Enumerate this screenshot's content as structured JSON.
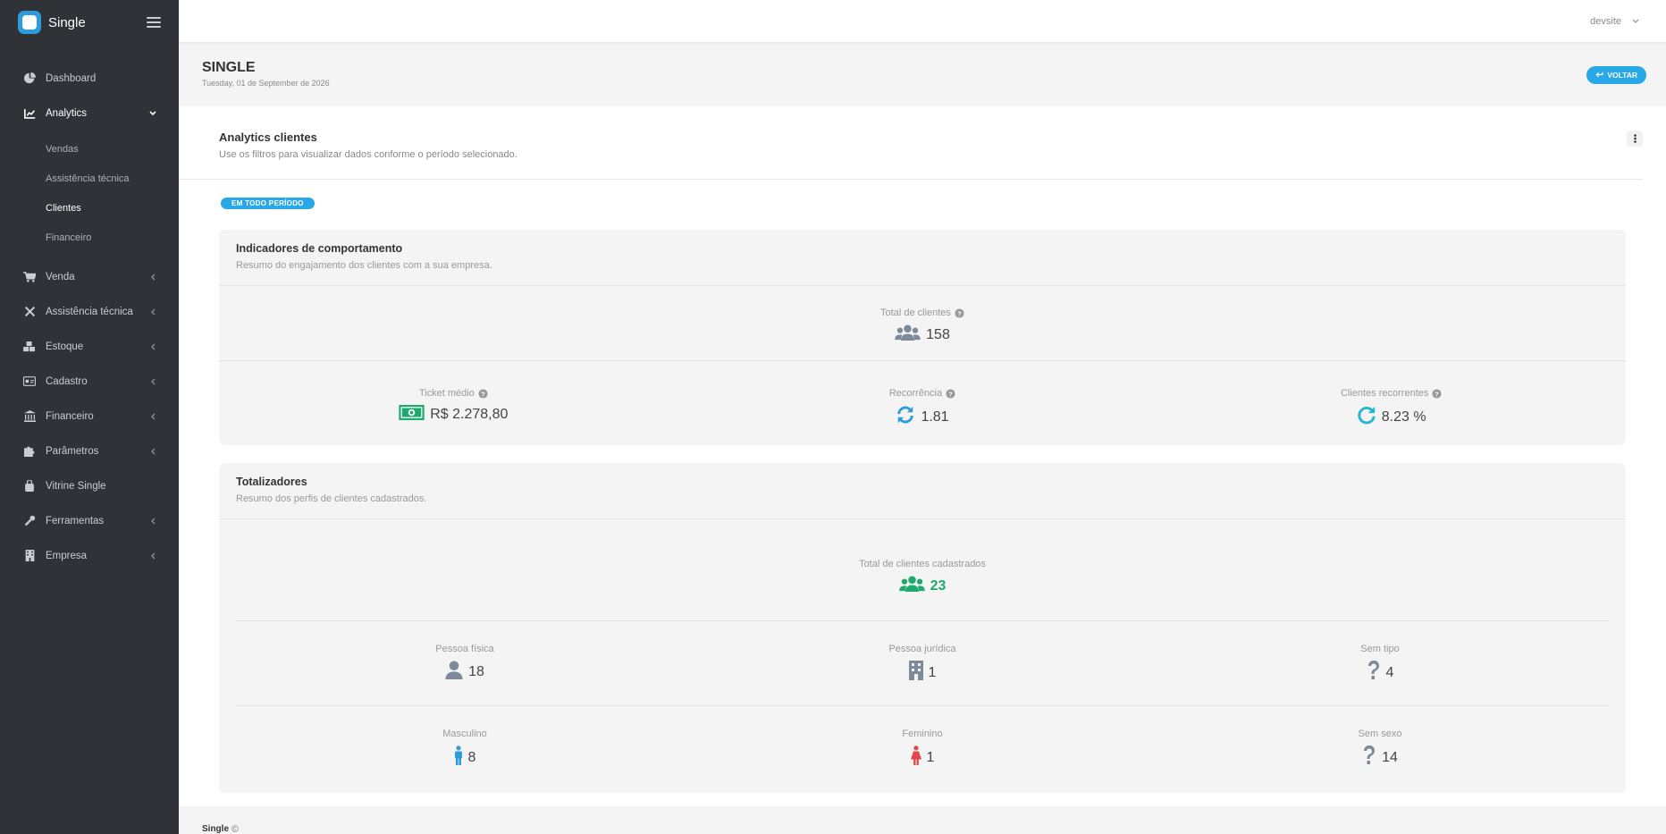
{
  "app": {
    "name": "Single"
  },
  "sidebar": {
    "items": [
      {
        "label": "Dashboard",
        "icon": "pie-chart-icon"
      },
      {
        "label": "Analytics",
        "icon": "line-chart-icon",
        "expanded": true,
        "children": [
          "Vendas",
          "Assistência técnica",
          "Clientes",
          "Financeiro"
        ],
        "current": "Clientes"
      },
      {
        "label": "Venda",
        "icon": "cart-icon"
      },
      {
        "label": "Assistência técnica",
        "icon": "tools-icon"
      },
      {
        "label": "Estoque",
        "icon": "cubes-icon"
      },
      {
        "label": "Cadastro",
        "icon": "id-card-icon"
      },
      {
        "label": "Financeiro",
        "icon": "bank-icon"
      },
      {
        "label": "Parâmetros",
        "icon": "puzzle-icon"
      },
      {
        "label": "Vitrine Single",
        "icon": "shopping-bag-icon"
      },
      {
        "label": "Ferramentas",
        "icon": "wrench-icon"
      },
      {
        "label": "Empresa",
        "icon": "building-icon"
      }
    ]
  },
  "topbar": {
    "user": "devsite"
  },
  "header": {
    "title": "SINGLE",
    "date": "Tuesday, 01 de September de 2026",
    "back_label": "VOLTAR"
  },
  "card": {
    "title": "Analytics clientes",
    "description": "Use os filtros para visualizar dados conforme o período selecionado.",
    "period_badge": "EM TODO PERÍODO"
  },
  "behavior": {
    "title": "Indicadores de comportamento",
    "description": "Resumo do engajamento dos clientes com a sua empresa.",
    "total_label": "Total de clientes",
    "total_value": "158",
    "ticket_label": "Ticket médio",
    "ticket_value": "R$ 2.278,80",
    "recurrence_label": "Recorrência",
    "recurrence_value": "1.81",
    "recurring_label": "Clientes recorrentes",
    "recurring_value": "8.23 %"
  },
  "totals": {
    "title": "Totalizadores",
    "description": "Resumo dos perfis de clientes cadastrados.",
    "registered_label": "Total de clientes cadastrados",
    "registered_value": "23",
    "pf_label": "Pessoa física",
    "pf_value": "18",
    "pj_label": "Pessoa jurídica",
    "pj_value": "1",
    "notype_label": "Sem tipo",
    "notype_value": "4",
    "male_label": "Masculino",
    "male_value": "8",
    "female_label": "Feminino",
    "female_value": "1",
    "nosex_label": "Sem sexo",
    "nosex_value": "14"
  },
  "footer": {
    "brand": "Single"
  },
  "colors": {
    "sidebar": "#2f3237",
    "accent": "#29a8e8",
    "green": "#1eaa6f",
    "female": "#e0474c",
    "male": "#2d9cdb",
    "gray_icon": "#7d8a99"
  }
}
